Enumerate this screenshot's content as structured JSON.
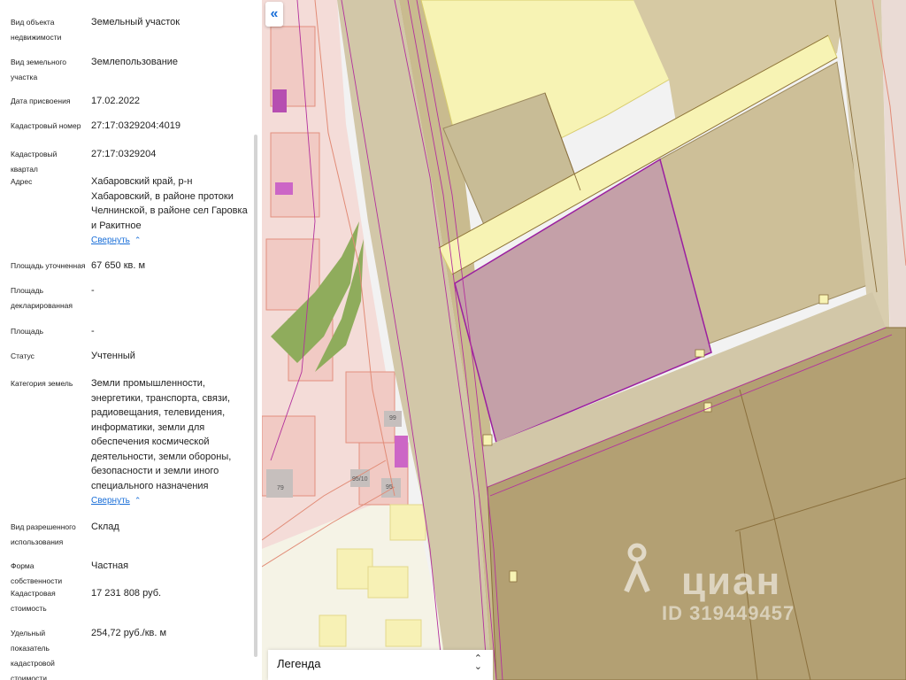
{
  "properties": [
    {
      "label": "Вид объекта недвижимости",
      "value": "Земельный участок"
    },
    {
      "label": "Вид земельного участка",
      "value": "Землепользование"
    },
    {
      "label": "Дата присвоения",
      "value": "17.02.2022"
    },
    {
      "label": "Кадастровый номер",
      "value": "27:17:0329204:4019"
    },
    {
      "label": "Кадастровый квартал",
      "value": "27:17:0329204"
    },
    {
      "label": "Адрес",
      "value": "Хабаровский край, р-н Хабаровский, в районе протоки Челнинской, в районе сел Гаровка и Ракитное"
    },
    {
      "label": "Площадь уточненная",
      "value": "67 650 кв. м"
    },
    {
      "label": "Площадь декларированная",
      "value": "-"
    },
    {
      "label": "Площадь",
      "value": "-"
    },
    {
      "label": "Статус",
      "value": "Учтенный"
    },
    {
      "label": "Категория земель",
      "value": "Земли промышленности, энергетики, транспорта, связи, радиовещания, телевидения, информатики, земли для обеспечения космической деятельности, земли обороны, безопасности и земли иного специального назначения"
    },
    {
      "label": "Вид разрешенного использования",
      "value": "Склад"
    },
    {
      "label": "Форма собственности",
      "value": "Частная"
    },
    {
      "label": "Кадастровая стоимость",
      "value": "17 231 808 руб."
    },
    {
      "label": "Удельный показатель кадастровой стоимости",
      "value": "254,72 руб./кв. м"
    }
  ],
  "collapse_link": "Свернуть",
  "collapse_icon": "chevron-up-icon",
  "map": {
    "collapse_button": "«",
    "legend": "Легенда",
    "legend_icon": "chevron-up-down-icon",
    "house_numbers": [
      "99",
      "95/10",
      "95",
      "79"
    ],
    "watermark_brand": "циан",
    "watermark_id": "ID 319449457"
  },
  "colors": {
    "link": "#1a6fd8",
    "selected_parcel": "#c4a0a8",
    "selected_border": "#9b1fa0",
    "industrial": "#b3a073",
    "yellow_zone": "#f6f1ae",
    "green": "#8fac5c"
  }
}
